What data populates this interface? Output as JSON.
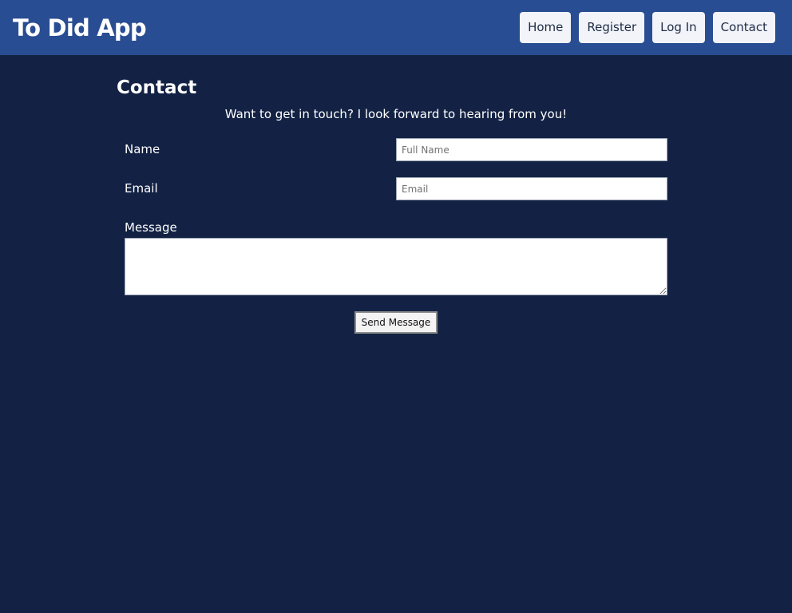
{
  "header": {
    "app_title": "To Did App",
    "nav": [
      {
        "label": "Home"
      },
      {
        "label": "Register"
      },
      {
        "label": "Log In"
      },
      {
        "label": "Contact"
      }
    ]
  },
  "main": {
    "title": "Contact",
    "intro": "Want to get in touch? I look forward to hearing from you!",
    "form": {
      "name": {
        "label": "Name",
        "value": "",
        "placeholder": "Full Name"
      },
      "email": {
        "label": "Email",
        "value": "",
        "placeholder": "Email"
      },
      "message": {
        "label": "Message",
        "value": "",
        "placeholder": ""
      },
      "submit_label": "Send Message"
    }
  },
  "colors": {
    "background": "#132244",
    "header_background": "#294d93",
    "nav_button_background": "#f2f4fa",
    "text": "#ffffff"
  }
}
